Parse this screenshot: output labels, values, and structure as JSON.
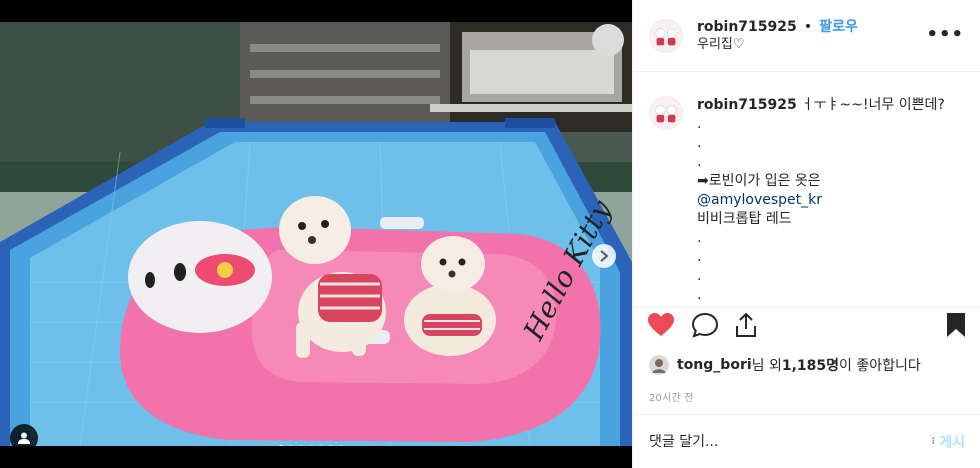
{
  "post": {
    "username": "robin715925",
    "separator": "•",
    "follow_label": "팔로우",
    "location": "우리집♡",
    "more_icon": "more-options-icon"
  },
  "caption": {
    "username": "robin715925",
    "lines": [
      "ㅓㅜㅑ~~!너무 이쁜데?",
      ".",
      ".",
      ".",
      "➡로빈이가 입은 옷은",
      "@amylovespet_kr",
      "비비크롭탑 레드",
      ".",
      ".",
      ".",
      "."
    ]
  },
  "actions": {
    "like_icon": "heart-icon",
    "comment_icon": "comment-icon",
    "share_icon": "share-icon",
    "save_icon": "bookmark-icon",
    "like_color": "#ed4956"
  },
  "likes": {
    "liker": "tong_bori",
    "text_mid": "님 외 ",
    "count": "1,185명",
    "text_end": "이 좋아합니다"
  },
  "timestamp": "20시간 전",
  "comment": {
    "placeholder": "댓글 달기...",
    "post_label": "게시"
  },
  "carousel": {
    "dot_count": 7,
    "active_index": 0
  }
}
